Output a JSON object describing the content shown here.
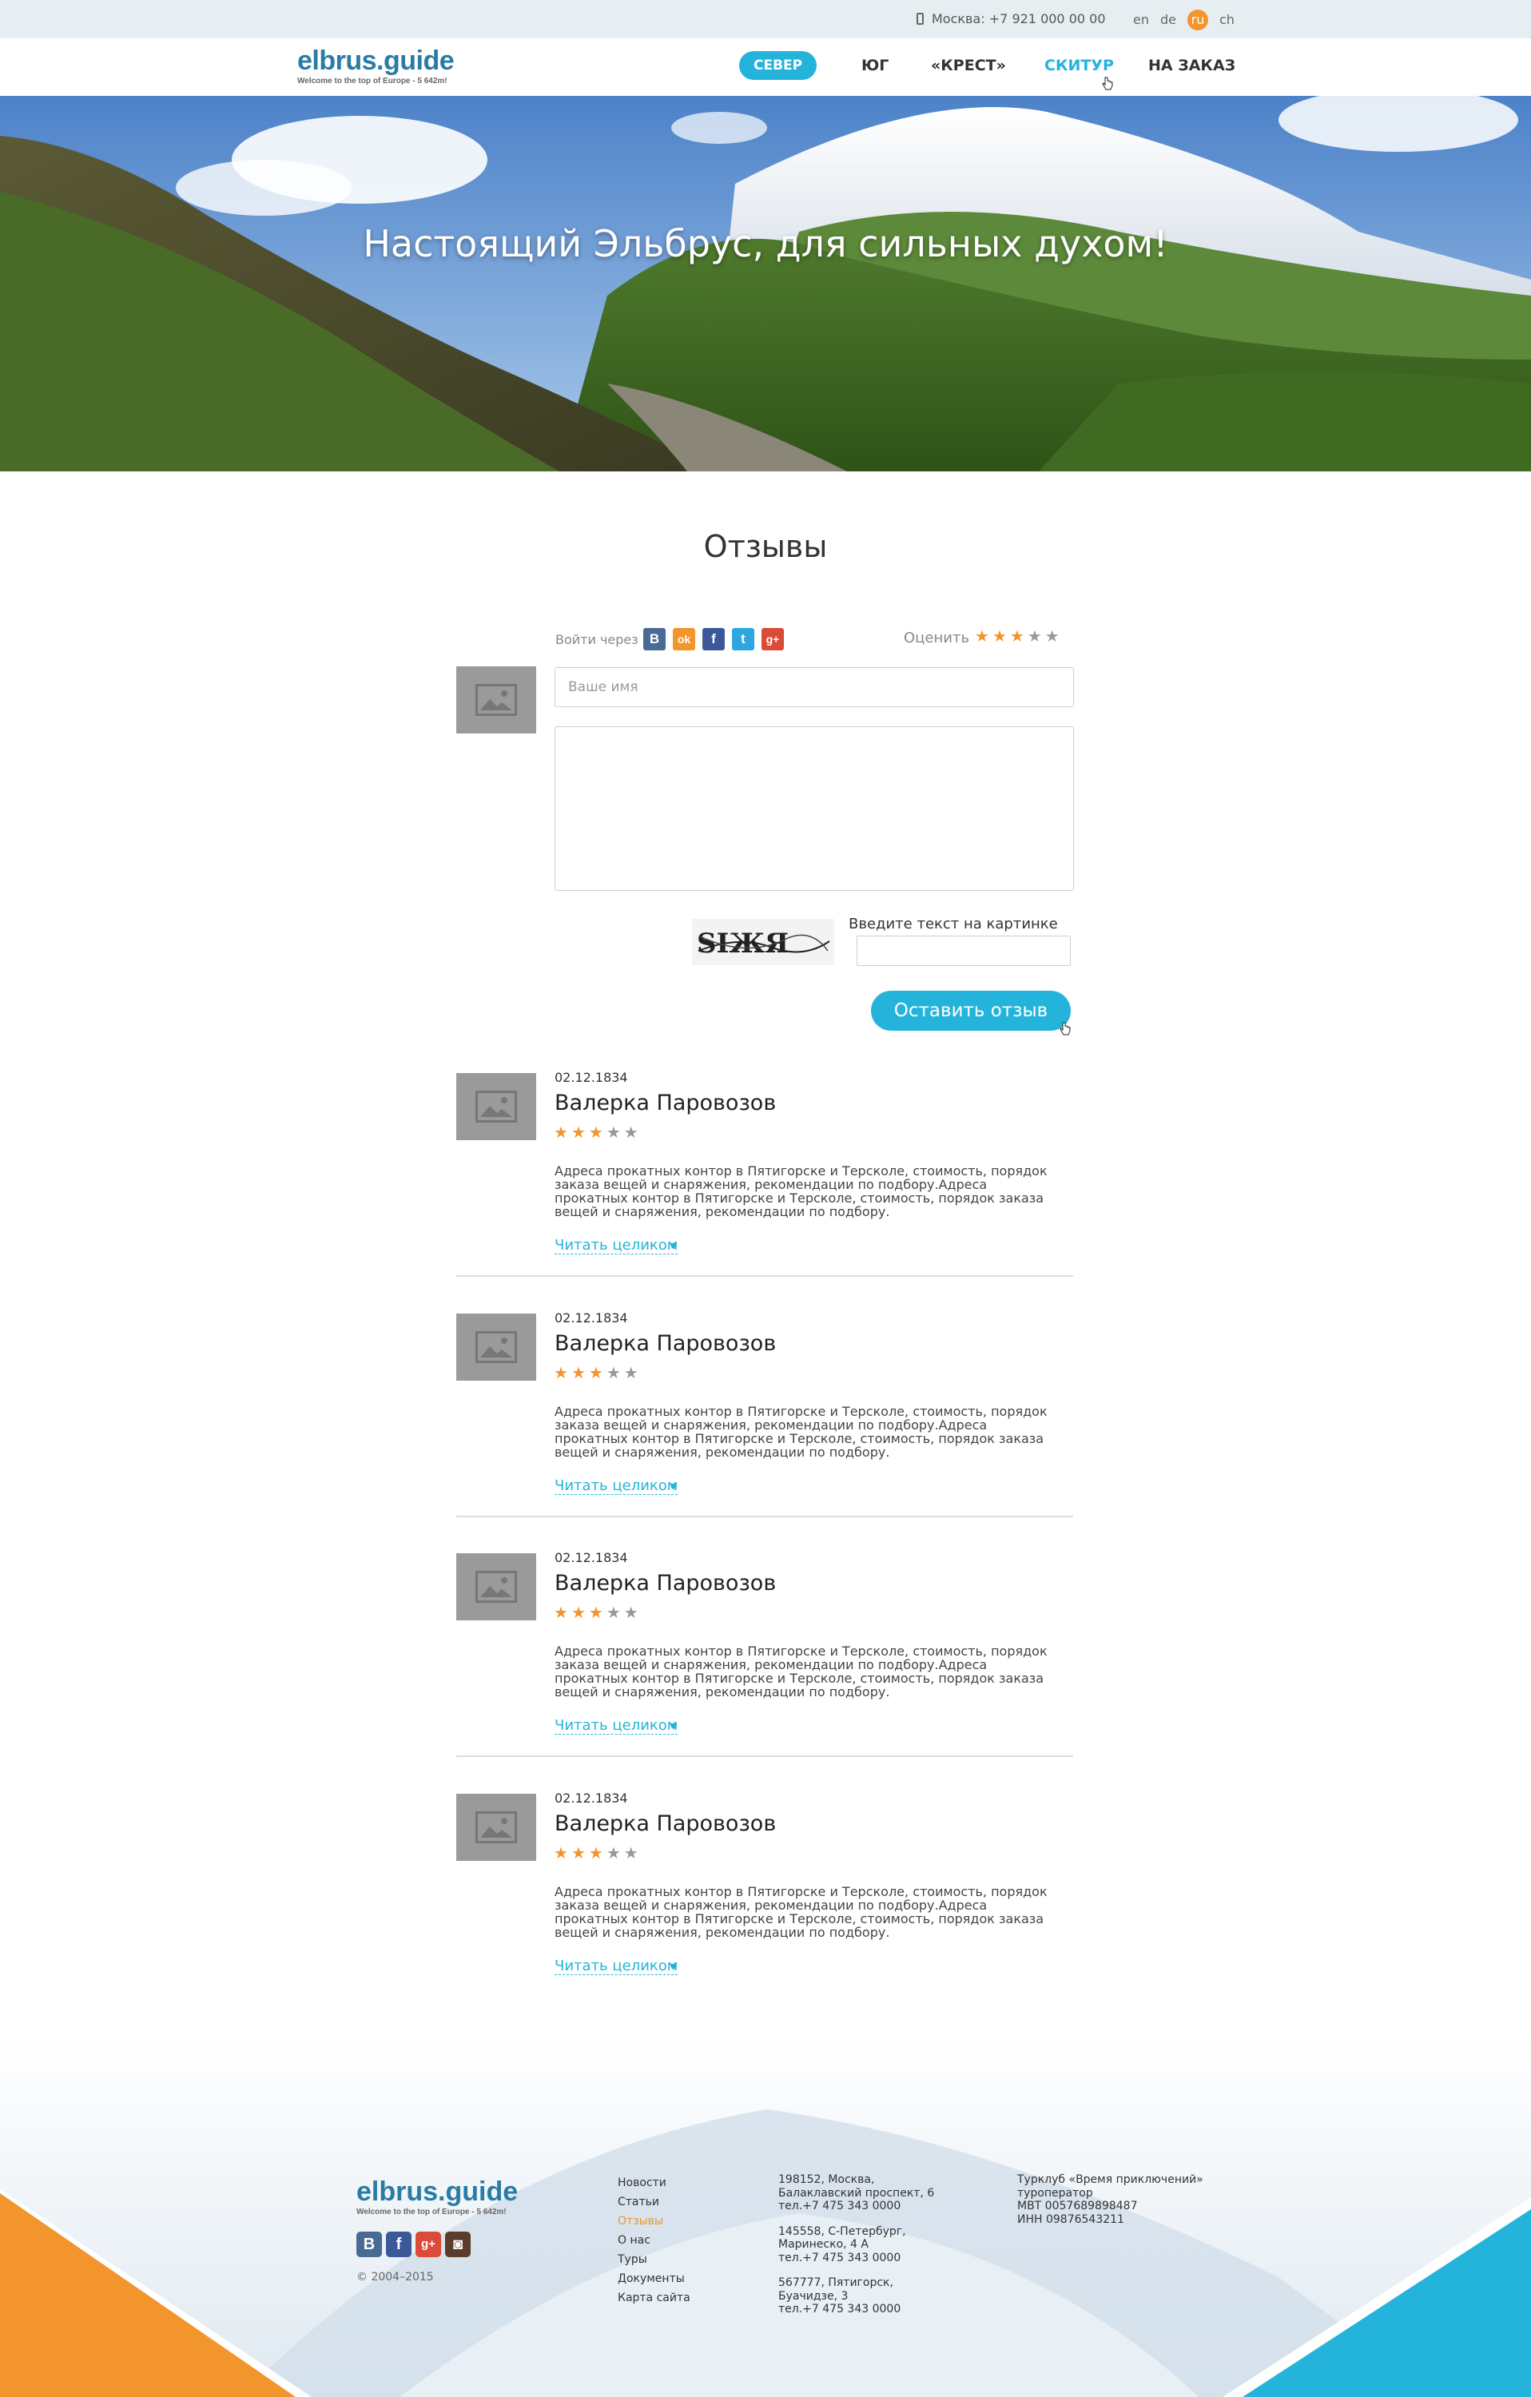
{
  "topbar": {
    "phone": "Москва: +7 921 000 00 00",
    "languages": [
      {
        "code": "en",
        "active": false
      },
      {
        "code": "de",
        "active": false
      },
      {
        "code": "ru",
        "active": true
      },
      {
        "code": "ch",
        "active": false
      }
    ]
  },
  "header": {
    "logo_name": "elbrus.guide",
    "logo_tagline": "Welcome to the top of Europe - 5 642m!",
    "nav": [
      {
        "label": "СЕВЕР",
        "state": "active"
      },
      {
        "label": "ЮГ",
        "state": "normal"
      },
      {
        "label": "«КРЕСТ»",
        "state": "normal"
      },
      {
        "label": "СКИТУР",
        "state": "hover"
      },
      {
        "label": "НА ЗАКАЗ",
        "state": "normal"
      }
    ]
  },
  "hero": {
    "title": "Настоящий Эльбрус, для сильных духом!"
  },
  "reviews_section": {
    "title": "Отзывы"
  },
  "form": {
    "login_via_label": "Войти через",
    "social_logins": [
      {
        "icon": "vk-icon",
        "glyph": "В",
        "color": "#4a6a96"
      },
      {
        "icon": "odnoklassniki-icon",
        "glyph": "ok",
        "color": "#f2952c"
      },
      {
        "icon": "facebook-icon",
        "glyph": "f",
        "color": "#3b5998"
      },
      {
        "icon": "twitter-icon",
        "glyph": "t",
        "color": "#2ea7e0"
      },
      {
        "icon": "google-plus-icon",
        "glyph": "g+",
        "color": "#dc4a38"
      }
    ],
    "rate_label": "Оценить",
    "rating": 3,
    "rating_max": 5,
    "name_placeholder": "Ваше имя",
    "captcha_text": "SIЖЯ",
    "captcha_label": "Введите текст на картинке",
    "submit_label": "Оставить отзыв"
  },
  "reviews": [
    {
      "date": "02.12.1834",
      "name": "Валерка Паровозов",
      "rating": 3,
      "text": "Адреса прокатных контор в Пятигорске и Терсколе, стоимость, порядок заказа вещей и снаряжения, рекомендации по подбору.Адреса прокатных контор в Пятигорске и Терсколе, стоимость, порядок заказа вещей и снаряжения, рекомендации по подбору.",
      "read_more": "Читать целиком"
    },
    {
      "date": "02.12.1834",
      "name": "Валерка Паровозов",
      "rating": 3,
      "text": "Адреса прокатных контор в Пятигорске и Терсколе, стоимость, порядок заказа вещей и снаряжения, рекомендации по подбору.Адреса прокатных контор в Пятигорске и Терсколе, стоимость, порядок заказа вещей и снаряжения, рекомендации по подбору.",
      "read_more": "Читать целиком"
    },
    {
      "date": "02.12.1834",
      "name": "Валерка Паровозов",
      "rating": 3,
      "text": "Адреса прокатных контор в Пятигорске и Терсколе, стоимость, порядок заказа вещей и снаряжения, рекомендации по подбору.Адреса прокатных контор в Пятигорске и Терсколе, стоимость, порядок заказа вещей и снаряжения, рекомендации по подбору.",
      "read_more": "Читать целиком"
    },
    {
      "date": "02.12.1834",
      "name": "Валерка Паровозов",
      "rating": 3,
      "text": "Адреса прокатных контор в Пятигорске и Терсколе, стоимость, порядок заказа вещей и снаряжения, рекомендации по подбору.Адреса прокатных контор в Пятигорске и Терсколе, стоимость, порядок заказа вещей и снаряжения, рекомендации по подбору.",
      "read_more": "Читать целиком"
    }
  ],
  "footer": {
    "logo_name": "elbrus.guide",
    "logo_tagline": "Welcome to the top of Europe - 5 642m!",
    "social": [
      {
        "icon": "vk-icon",
        "glyph": "В",
        "color": "#4a6a96"
      },
      {
        "icon": "facebook-icon",
        "glyph": "f",
        "color": "#3b5998"
      },
      {
        "icon": "google-plus-icon",
        "glyph": "g+",
        "color": "#dc4a38"
      },
      {
        "icon": "instagram-icon",
        "glyph": "◙",
        "color": "#5a3e2b"
      }
    ],
    "copyright": "© 2004–2015",
    "nav": [
      {
        "label": "Новости",
        "active": false
      },
      {
        "label": "Статьи",
        "active": false
      },
      {
        "label": "Отзывы",
        "active": true
      },
      {
        "label": "О нас",
        "active": false
      },
      {
        "label": "Туры",
        "active": false
      },
      {
        "label": "Документы",
        "active": false
      },
      {
        "label": "Карта сайта",
        "active": false
      }
    ],
    "addresses": [
      [
        "198152, Москва,",
        "Балаклавский проспект, 6",
        "тел.+7 475 343 0000"
      ],
      [
        "145558, С-Петербург,",
        "Маринеско, 4 А",
        "тел.+7 475 343 0000"
      ],
      [
        "567777, Пятигорск,",
        "Буачидзе, 3",
        "тел.+7 475 343 0000"
      ]
    ],
    "company": [
      "Турклуб «Время приключений»",
      "туроператор",
      "МВТ 0057689898487",
      "ИНН 09876543211"
    ]
  },
  "colors": {
    "accent": "#24b4db",
    "orange": "#f2952c",
    "brand": "#2a7ca4"
  }
}
